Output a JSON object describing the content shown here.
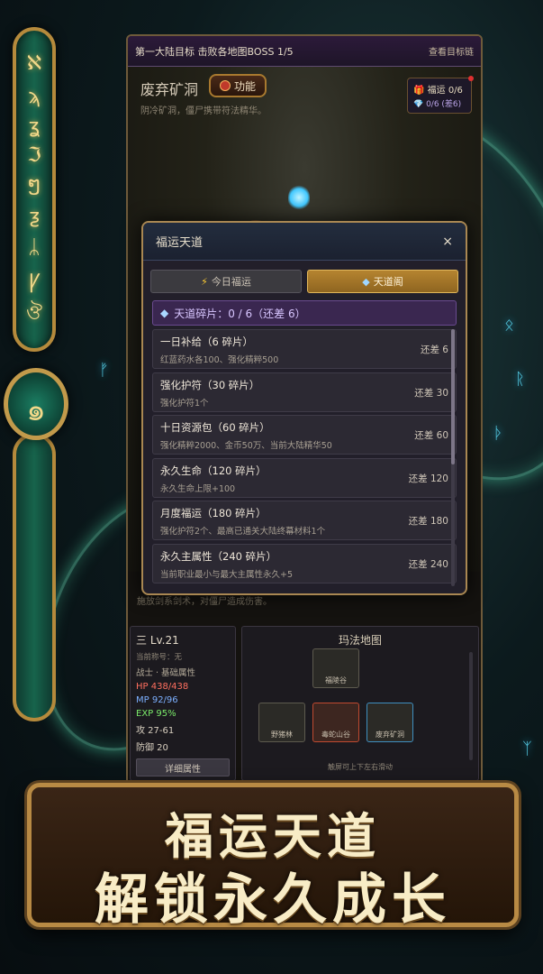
{
  "topbar": {
    "goal_text": "第一大陆目标  击败各地图BOSS 1/5",
    "goal_link": "查看目标链"
  },
  "scene": {
    "title": "废弃矿洞",
    "function_button": "功能",
    "subtitle": "阴冷矿洞，僵尸携带符法精华。",
    "fortune_chip": {
      "line1": "福运 0/6",
      "line2": "0/6 (差6)"
    },
    "bottom_text": "施放剑系剑术，对僵尸造成伤害。"
  },
  "modal": {
    "title": "福运天道",
    "close": "×",
    "tabs": [
      {
        "label": "今日福运",
        "icon": "bolt-icon",
        "active": false
      },
      {
        "label": "天道阁",
        "icon": "gem-icon",
        "active": true
      }
    ],
    "shard_bar": "天道碎片：0 / 6（还差 6）",
    "items": [
      {
        "name": "一日补给（6 碎片）",
        "desc": "红蓝药水各100、强化精粹500",
        "need": "还差 6"
      },
      {
        "name": "强化护符（30 碎片）",
        "desc": "强化护符1个",
        "need": "还差 30"
      },
      {
        "name": "十日资源包（60 碎片）",
        "desc": "强化精粹2000、金币50万、当前大陆精华50",
        "need": "还差 60"
      },
      {
        "name": "永久生命（120 碎片）",
        "desc": "永久生命上限+100",
        "need": "还差 120"
      },
      {
        "name": "月度福运（180 碎片）",
        "desc": "强化护符2个、最高已通关大陆终幕材料1个",
        "need": "还差 180"
      },
      {
        "name": "永久主属性（240 碎片）",
        "desc": "当前职业最小与最大主属性永久+5",
        "need": "还差 240"
      }
    ]
  },
  "character": {
    "level": "三 Lv.21",
    "title_line": "当前称号：无",
    "class_line": "战士 · 基础属性",
    "hp": "HP 438/438",
    "mp": "MP 92/96",
    "exp": "EXP 95%",
    "atk": "攻 27-61",
    "def": "防御 20",
    "detail_button": "详细属性"
  },
  "map": {
    "title": "玛法地图",
    "nodes": [
      "福陵谷",
      "野猪林",
      "毒蛇山谷",
      "废弃矿洞"
    ],
    "hint": "触屏可上下左右滑动"
  },
  "banner": {
    "line1": "福运天道",
    "line2": "解锁永久成长"
  },
  "pillar": {
    "runes": [
      "ℵ",
      "ϡ",
      "ʓ",
      "ℑ",
      "ໆ",
      "ƺ",
      "ᛦ",
      "Ꝩ",
      "ঔ"
    ],
    "orb_glyph": "๑"
  },
  "colors": {
    "accent_gold": "#b58430",
    "shard_purple": "#3a2750",
    "hp": "#ff6f5f",
    "mp": "#7cb0ff",
    "exp": "#7bea6a"
  }
}
